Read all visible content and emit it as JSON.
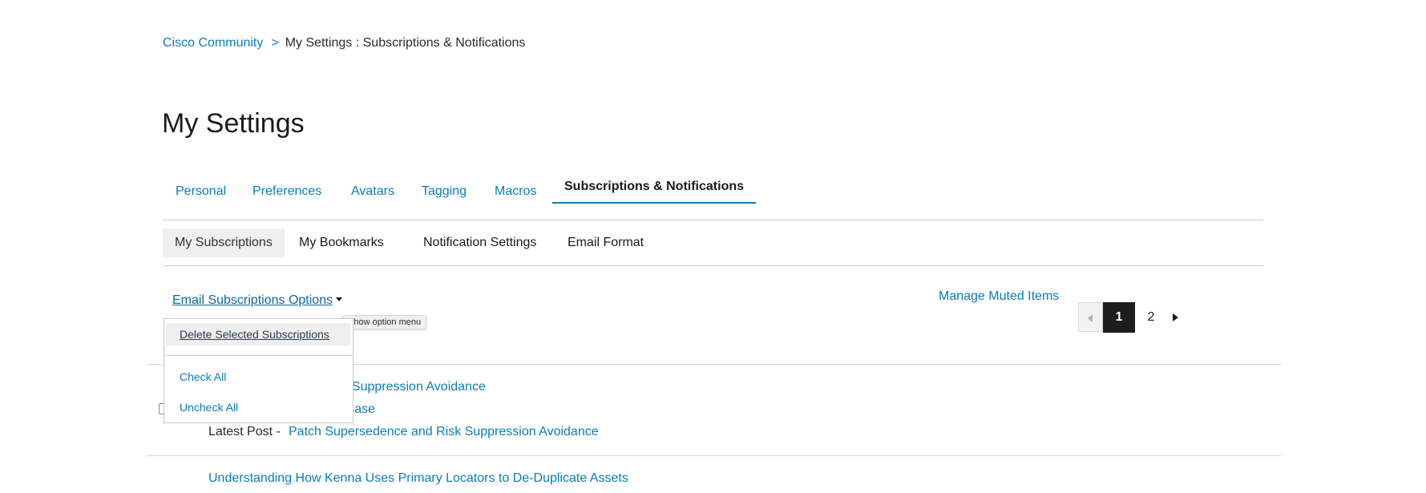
{
  "breadcrumb": {
    "home": "Cisco Community",
    "separator": ">",
    "current": "My Settings : Subscriptions & Notifications"
  },
  "page_title": "My Settings",
  "main_tabs": [
    {
      "label": "Personal"
    },
    {
      "label": "Preferences"
    },
    {
      "label": "Avatars"
    },
    {
      "label": "Tagging"
    },
    {
      "label": "Macros"
    },
    {
      "label": "Subscriptions & Notifications",
      "active": true
    }
  ],
  "sub_tabs": [
    {
      "label": "My Subscriptions",
      "active": true
    },
    {
      "label": "My Bookmarks"
    },
    {
      "label": "Notification Settings"
    },
    {
      "label": "Email Format"
    }
  ],
  "options": {
    "label": "Email Subscriptions Options",
    "tooltip": "Show option menu",
    "menu": [
      "Delete Selected Subscriptions",
      "Check All",
      "Uncheck All"
    ]
  },
  "manage_muted": "Manage Muted Items",
  "pagination": {
    "current": "1",
    "next": "2"
  },
  "rows": [
    {
      "title_fragment": "d Risk Suppression Avoidance",
      "board_fragment": "ledge Base",
      "latest_label": "Latest Post -",
      "latest_link": "Patch Supersedence and Risk Suppression Avoidance"
    },
    {
      "title": "Understanding How Kenna Uses Primary Locators to De-Duplicate Assets"
    }
  ],
  "colors": {
    "link": "#0a7cb8",
    "active_tab_underline": "#0a7cb8",
    "pager_active": "#1d1d1d"
  }
}
